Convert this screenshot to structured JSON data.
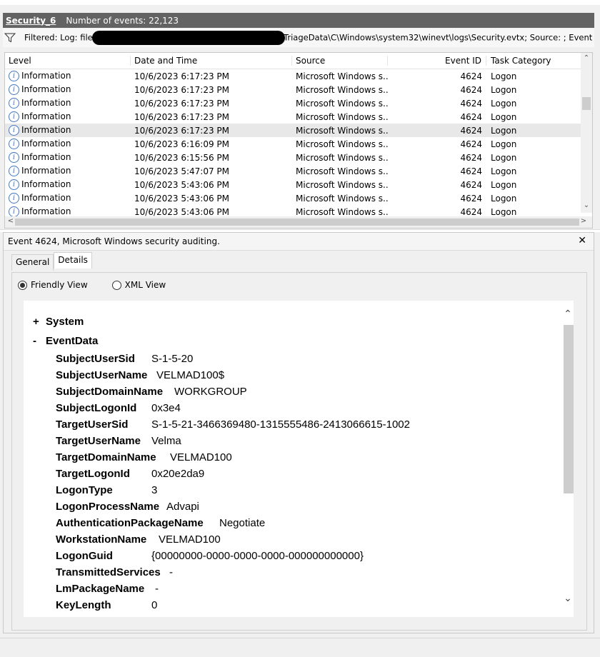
{
  "log": {
    "name": "Security_6",
    "count_label": "Number of events: 22,123"
  },
  "filter": {
    "prefix": "Filtered: Log: file:/",
    "suffix": "_output\\TriageData\\C\\Windows\\system32\\winevt\\logs\\Security.evtx; Source: ; Event ID:"
  },
  "grid": {
    "columns": [
      "Level",
      "Date and Time",
      "Source",
      "Event ID",
      "Task Category"
    ],
    "rows": [
      {
        "level": "Information",
        "date": "10/6/2023 6:17:23 PM",
        "source": "Microsoft Windows s...",
        "eid": "4624",
        "task": "Logon"
      },
      {
        "level": "Information",
        "date": "10/6/2023 6:17:23 PM",
        "source": "Microsoft Windows s...",
        "eid": "4624",
        "task": "Logon"
      },
      {
        "level": "Information",
        "date": "10/6/2023 6:17:23 PM",
        "source": "Microsoft Windows s...",
        "eid": "4624",
        "task": "Logon"
      },
      {
        "level": "Information",
        "date": "10/6/2023 6:17:23 PM",
        "source": "Microsoft Windows s...",
        "eid": "4624",
        "task": "Logon"
      },
      {
        "level": "Information",
        "date": "10/6/2023 6:17:23 PM",
        "source": "Microsoft Windows s...",
        "eid": "4624",
        "task": "Logon",
        "selected": true
      },
      {
        "level": "Information",
        "date": "10/6/2023 6:16:09 PM",
        "source": "Microsoft Windows s...",
        "eid": "4624",
        "task": "Logon"
      },
      {
        "level": "Information",
        "date": "10/6/2023 6:15:56 PM",
        "source": "Microsoft Windows s...",
        "eid": "4624",
        "task": "Logon"
      },
      {
        "level": "Information",
        "date": "10/6/2023 5:47:07 PM",
        "source": "Microsoft Windows s...",
        "eid": "4624",
        "task": "Logon"
      },
      {
        "level": "Information",
        "date": "10/6/2023 5:43:06 PM",
        "source": "Microsoft Windows s...",
        "eid": "4624",
        "task": "Logon"
      },
      {
        "level": "Information",
        "date": "10/6/2023 5:43:06 PM",
        "source": "Microsoft Windows s...",
        "eid": "4624",
        "task": "Logon"
      },
      {
        "level": "Information",
        "date": "10/6/2023 5:43:06 PM",
        "source": "Microsoft Windows s...",
        "eid": "4624",
        "task": "Logon"
      }
    ]
  },
  "detail": {
    "title": "Event 4624, Microsoft Windows security auditing.",
    "close": "✕",
    "tabs": [
      "General",
      "Details"
    ],
    "view_friendly": "Friendly View",
    "view_xml": "XML View",
    "system_sign": "+",
    "system_label": "System",
    "eventdata_sign": "-",
    "eventdata_label": "EventData",
    "fields": [
      {
        "k": "SubjectUserSid",
        "v": "S-1-5-20"
      },
      {
        "k": "SubjectUserName",
        "v": "VELMAD100$"
      },
      {
        "k": "SubjectDomainName",
        "v": "WORKGROUP"
      },
      {
        "k": "SubjectLogonId",
        "v": "0x3e4"
      },
      {
        "k": "TargetUserSid",
        "v": "S-1-5-21-3466369480-1315555486-2413066615-1002"
      },
      {
        "k": "TargetUserName",
        "v": "Velma"
      },
      {
        "k": "TargetDomainName",
        "v": "VELMAD100"
      },
      {
        "k": "TargetLogonId",
        "v": "0x20e2da9"
      },
      {
        "k": "LogonType",
        "v": "3"
      },
      {
        "k": "LogonProcessName",
        "v": "Advapi"
      },
      {
        "k": "AuthenticationPackageName",
        "v": "Negotiate"
      },
      {
        "k": "WorkstationName",
        "v": "VELMAD100"
      },
      {
        "k": "LogonGuid",
        "v": "{00000000-0000-0000-0000-000000000000}"
      },
      {
        "k": "TransmittedServices",
        "v": "-"
      },
      {
        "k": "LmPackageName",
        "v": "-"
      },
      {
        "k": "KeyLength",
        "v": "0"
      }
    ]
  },
  "icons": {
    "info": "i",
    "filter": "filter-icon",
    "up": "⌃",
    "down": "⌄",
    "left": "<",
    "right": ">"
  }
}
